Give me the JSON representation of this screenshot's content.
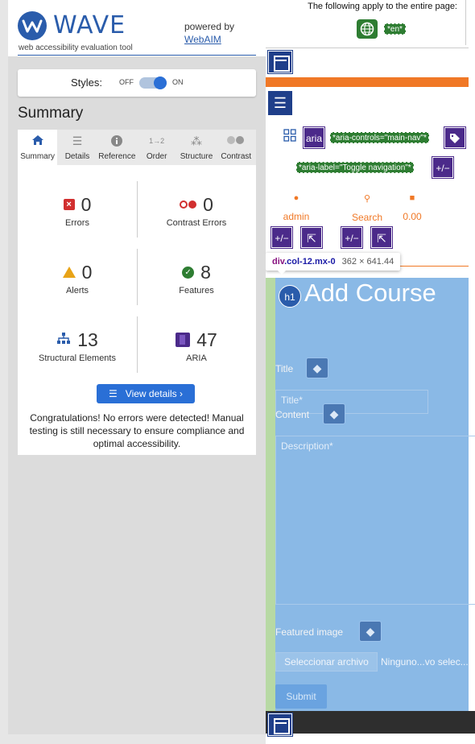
{
  "wave": {
    "logo_text": "WAVE",
    "logo_sub": "web accessibility evaluation tool",
    "powered_by": "powered by",
    "webaim_link": "WebAIM",
    "styles": {
      "label": "Styles:",
      "off": "OFF",
      "on": "ON",
      "state": "on"
    },
    "summary_title": "Summary",
    "tabs": [
      {
        "label": "Summary",
        "icon": "home-icon",
        "active": true
      },
      {
        "label": "Details",
        "icon": "list-icon",
        "active": false
      },
      {
        "label": "Reference",
        "icon": "info-icon",
        "active": false
      },
      {
        "label": "Order",
        "icon": "order-icon",
        "active": false
      },
      {
        "label": "Structure",
        "icon": "structure-icon",
        "active": false
      },
      {
        "label": "Contrast",
        "icon": "contrast-icon",
        "active": false
      }
    ],
    "stats": {
      "errors": {
        "count": "0",
        "label": "Errors",
        "icon": "error-icon"
      },
      "contrast_errors": {
        "count": "0",
        "label": "Contrast Errors",
        "icon": "contrast-error-icon"
      },
      "alerts": {
        "count": "0",
        "label": "Alerts",
        "icon": "alert-icon"
      },
      "features": {
        "count": "8",
        "label": "Features",
        "icon": "feature-icon"
      },
      "structural": {
        "count": "13",
        "label": "Structural Elements",
        "icon": "structure-icon"
      },
      "aria": {
        "count": "47",
        "label": "ARIA",
        "icon": "aria-icon"
      }
    },
    "view_details": "View details ›",
    "congrats": "Congratulations! No errors were detected! Manual testing is still necessary to ensure compliance and optimal accessibility."
  },
  "page": {
    "apply_text": "The following apply to the entire page:",
    "lang_tag": "*en*",
    "aria_controls": "*aria-controls=\"main-nav\"*",
    "aria_label": "*aria-label=\"Toggle navigation\"*",
    "aria_icon_text": "aria",
    "pm_text": "+/−",
    "nav": {
      "admin": "admin",
      "search": "Search",
      "cart": "0.00"
    },
    "tooltip": {
      "tag": "div",
      "cls": ".col-12.mx-0",
      "dims": "362 × 641.44"
    },
    "h1_badge": "h1",
    "heading": "Add Course",
    "title_label": "Title",
    "title_placeholder": "Title*",
    "content_label": "Content",
    "description_placeholder": "Description*",
    "featured_label": "Featured image",
    "file_button": "Seleccionar archivo",
    "file_status": "Ninguno...vo selec...",
    "submit": "Submit"
  },
  "colors": {
    "wave_blue": "#2a5cab",
    "accent_orange": "#f07826",
    "aria_purple": "#4b2a8a",
    "feature_green": "#2e7d32",
    "highlight_blue": "#8ab9e6"
  }
}
